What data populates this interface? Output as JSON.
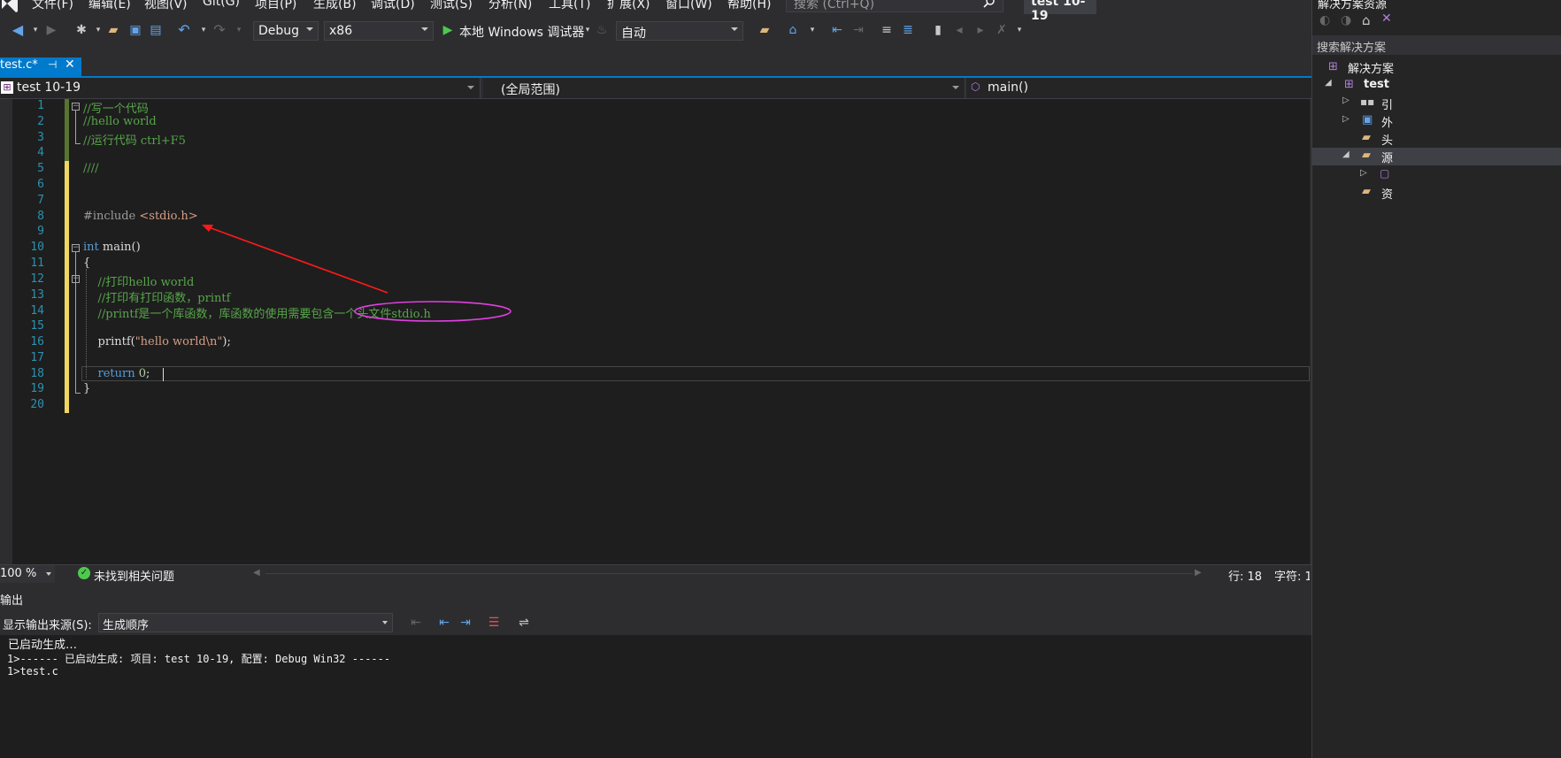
{
  "menu": {
    "items": [
      "文件(F)",
      "编辑(E)",
      "视图(V)",
      "Git(G)",
      "项目(P)",
      "生成(B)",
      "调试(D)",
      "测试(S)",
      "分析(N)",
      "工具(T)",
      "扩展(X)",
      "窗口(W)",
      "帮助(H)"
    ],
    "search_placeholder": "搜索 (Ctrl+Q)",
    "title": "test 10-19"
  },
  "toolbar": {
    "configuration": "Debug",
    "platform": "x86",
    "run_label": "本地 Windows 调试器",
    "mode": "自动"
  },
  "tab": {
    "label": "test.c*",
    "pin": "⊣",
    "close": "✕"
  },
  "navbar": {
    "project": "test 10-19",
    "scope": "(全局范围)",
    "member": "main()"
  },
  "code": {
    "lines": [
      "//写一个代码",
      "//hello world",
      "//运行代码 ctrl+F5",
      "",
      "////",
      "",
      "",
      "#include <stdio.h>",
      "",
      "int main()",
      "{",
      "    //打印hello world",
      "    //打印有打印函数，printf",
      "    //printf是一个库函数，库函数的使用需要包含一个头文件stdio.h",
      "",
      "    printf(\"hello world\\n\");",
      "",
      "    return 0;",
      "}",
      ""
    ]
  },
  "status": {
    "zoom": "100 %",
    "issues": "未找到相关问题",
    "line": "行: 18",
    "char": "字符: 1"
  },
  "output": {
    "title": "输出",
    "source_label": "显示输出来源(S):",
    "source_value": "生成顺序",
    "lines": [
      "已启动生成…",
      "1>------ 已启动生成: 项目: test 10-19, 配置: Debug Win32 ------",
      "1>test.c"
    ]
  },
  "solution": {
    "header": "解决方案资源",
    "search_label": "搜索解决方案",
    "solution_node": "解决方案",
    "project_node": "test",
    "children": [
      "引",
      "外",
      "头",
      "源",
      "资"
    ]
  }
}
